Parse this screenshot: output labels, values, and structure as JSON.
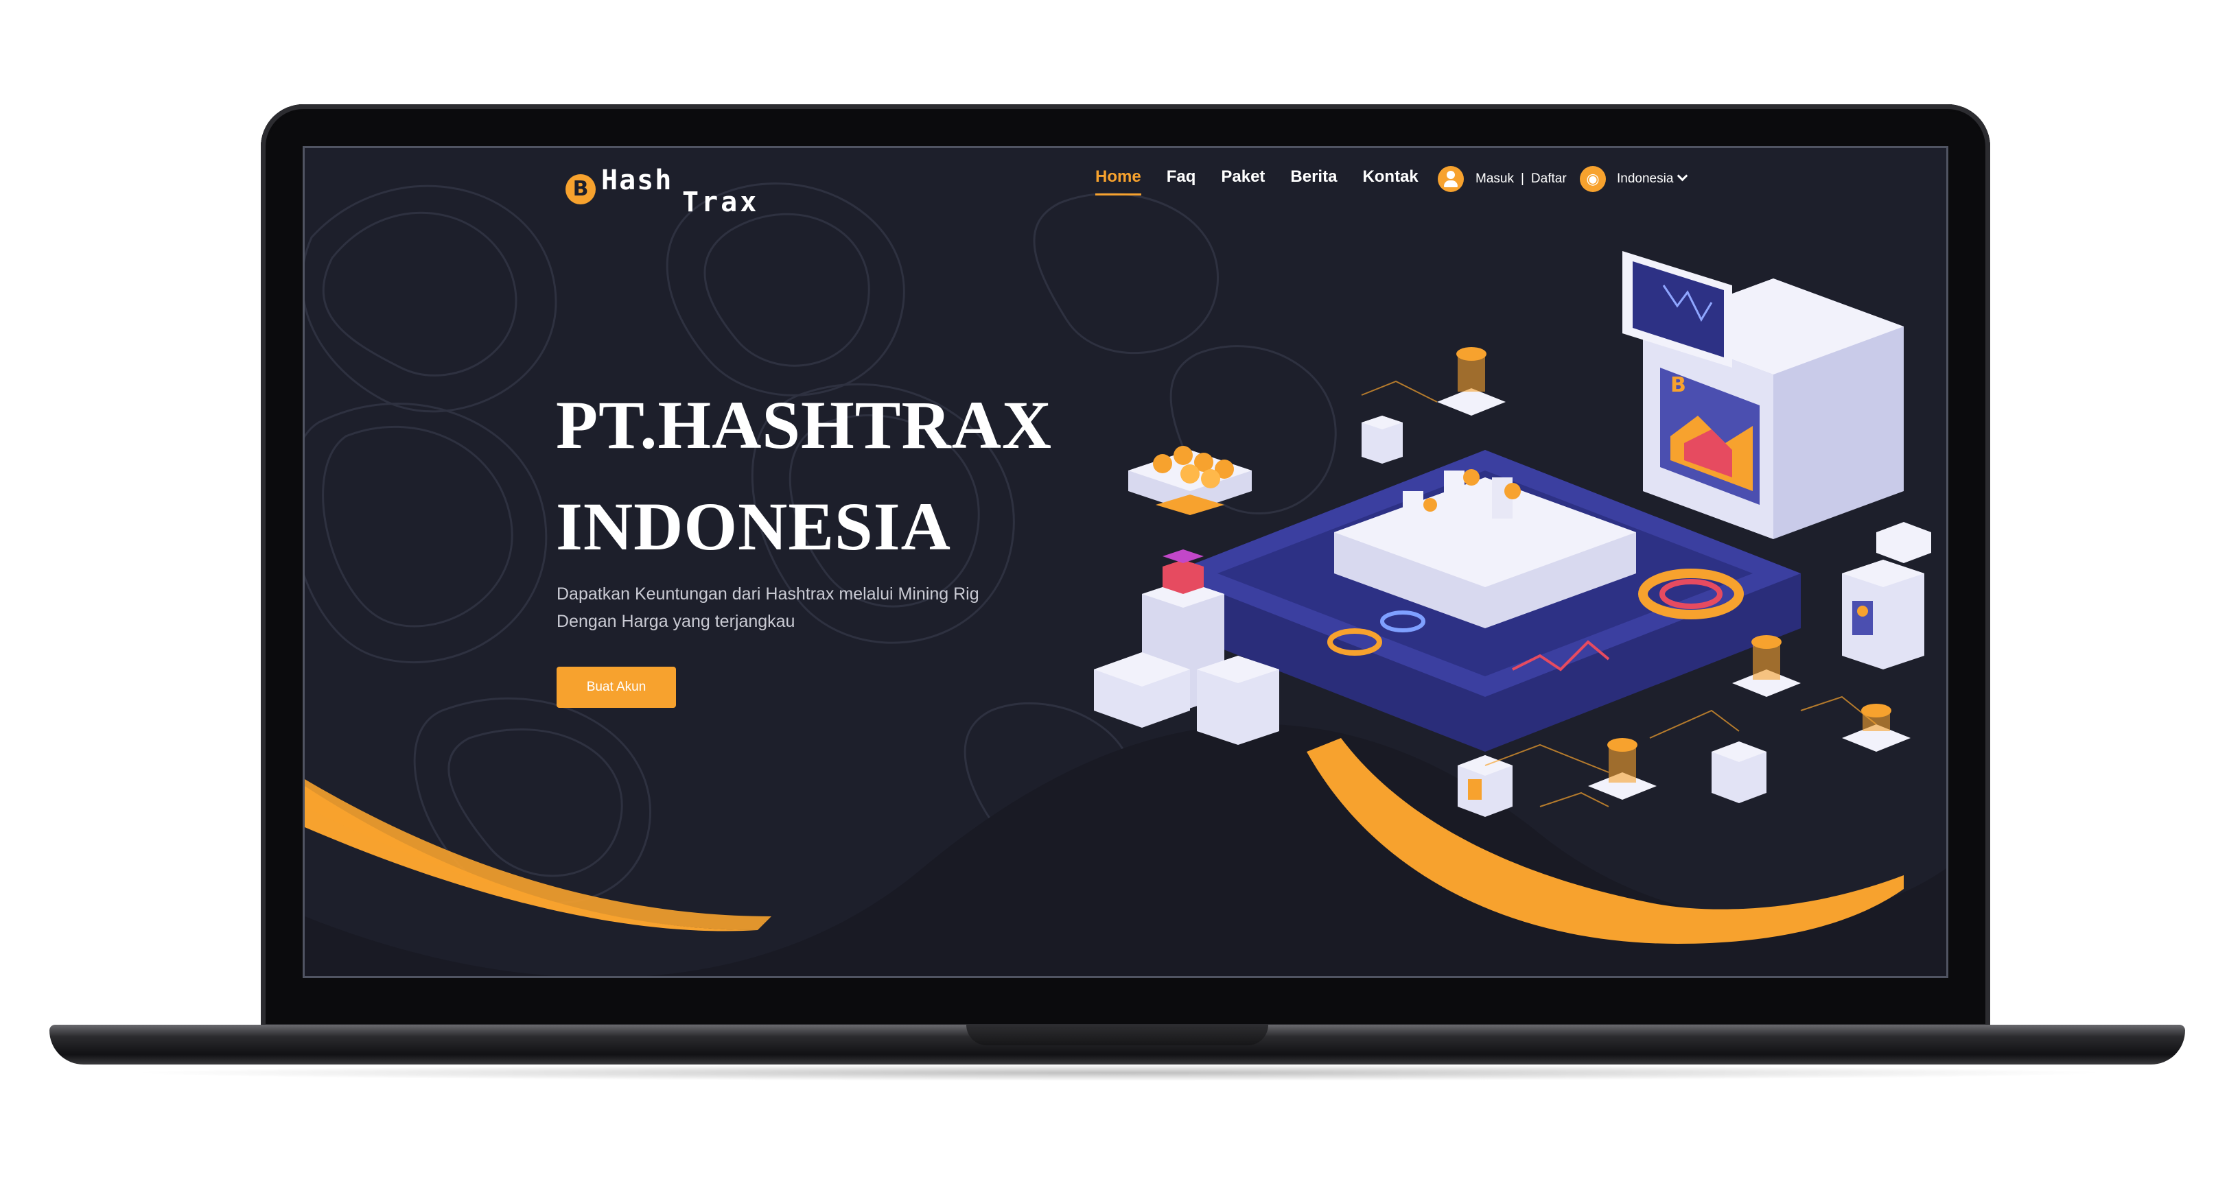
{
  "brand": {
    "logo_coin": "B",
    "logo_word_1": "Hash",
    "logo_word_2": "Trax"
  },
  "nav": {
    "items": [
      {
        "label": "Home",
        "active": true
      },
      {
        "label": "Faq",
        "active": false
      },
      {
        "label": "Paket",
        "active": false
      },
      {
        "label": "Berita",
        "active": false
      },
      {
        "label": "Kontak",
        "active": false
      }
    ]
  },
  "auth": {
    "login_label": "Masuk",
    "separator": "|",
    "register_label": "Daftar"
  },
  "language": {
    "selected": "Indonesia"
  },
  "hero": {
    "title_line_1": "PT.HASHTRAX",
    "title_line_2": "INDONESIA",
    "subtitle_line_1": "Dapatkan Keuntungan dari Hashtrax melalui Mining Rig",
    "subtitle_line_2": "Dengan Harga yang terjangkau",
    "cta_label": "Buat Akun"
  },
  "colors": {
    "accent": "#f7a22e",
    "background": "#1d1f2b",
    "illustration_purple": "#4b4fb0",
    "illustration_white": "#e8e8f6"
  },
  "icons": [
    "bitcoin-coin-icon",
    "user-icon",
    "globe-icon",
    "chevron-down-icon"
  ]
}
